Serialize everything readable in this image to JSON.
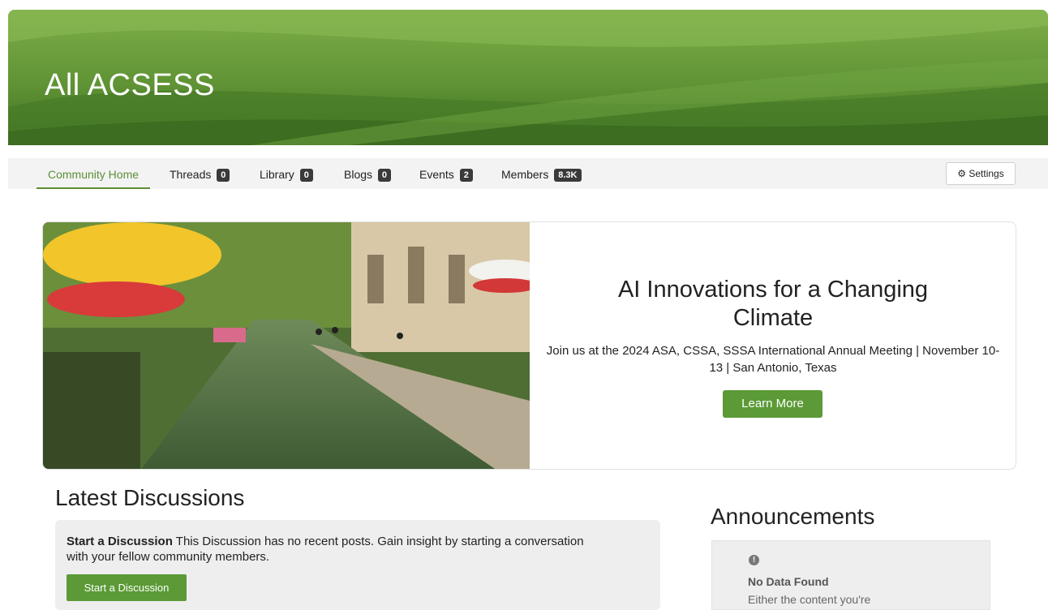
{
  "banner": {
    "title": "All ACSESS"
  },
  "nav": {
    "items": [
      {
        "label": "Community Home"
      },
      {
        "label": "Threads",
        "count": "0"
      },
      {
        "label": "Library",
        "count": "0"
      },
      {
        "label": "Blogs",
        "count": "0"
      },
      {
        "label": "Events",
        "count": "2"
      },
      {
        "label": "Members",
        "count": "8.3K"
      }
    ],
    "settings_label": "Settings",
    "settings_icon": "gear-icon"
  },
  "hero": {
    "title": "AI Innovations for a Changing Climate",
    "subtitle": "Join us at the 2024 ASA, CSSA, SSSA International Annual Meeting | November 10-13 | San Antonio, Texas",
    "button_label": "Learn More"
  },
  "discussions": {
    "heading": "Latest Discussions",
    "lead": "Start a Discussion",
    "body": " This Discussion has no recent posts. Gain insight by starting a conversation with your fellow community members.",
    "button_label": "Start a Discussion"
  },
  "announcements": {
    "heading": "Announcements",
    "icon": "exclamation-circle-icon",
    "empty_title": "No Data Found",
    "empty_desc": "Either the content you're"
  },
  "colors": {
    "brand_green": "#5b9a36",
    "active_tab": "#5b8f34",
    "badge": "#3a3a3a"
  }
}
